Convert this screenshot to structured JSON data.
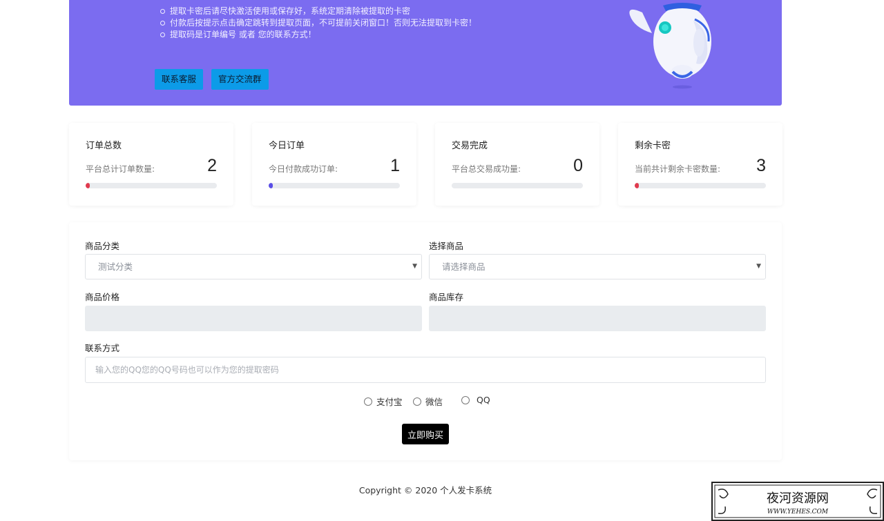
{
  "banner": {
    "notes": [
      "提取卡密后请尽快激活使用或保存好，系统定期清除被提取的卡密",
      "付款后按提示点击确定跳转到提取页面，不可提前关闭窗口！否则无法提取到卡密！",
      "提取码是订单编号 或者 您的联系方式！"
    ],
    "service_button": "联系客服",
    "group_button": "官方交流群",
    "color": "#7b6cf0"
  },
  "stats": [
    {
      "title": "订单总数",
      "subtitle": "平台总计订单数量:",
      "value": "2",
      "progress": 0.02,
      "bar_color": "#e03a4e"
    },
    {
      "title": "今日订单",
      "subtitle": "今日付款成功订单:",
      "value": "1",
      "progress": 0.01,
      "bar_color": "#5a4ee6"
    },
    {
      "title": "交易完成",
      "subtitle": "平台总交易成功量:",
      "value": "0",
      "progress": 0,
      "bar_color": "#28a745"
    },
    {
      "title": "剩余卡密",
      "subtitle": "当前共计剩余卡密数量:",
      "value": "3",
      "progress": 0.03,
      "bar_color": "#e03a4e"
    }
  ],
  "form": {
    "category_label": "商品分类",
    "category_value": "测试分类",
    "product_label": "选择商品",
    "product_value": "请选择商品",
    "price_label": "商品价格",
    "stock_label": "商品库存",
    "contact_label": "联系方式",
    "contact_placeholder": "输入您的QQ您的QQ号码也可以作为您的提取密码",
    "payment_options": [
      "支付宝",
      "微信",
      "QQ"
    ],
    "buy_button": "立即购买"
  },
  "footer": {
    "copyright": "Copyright © 2020 个人发卡系统"
  },
  "watermark": {
    "text": "夜河资源网",
    "url_text": "WWW.YEHES.COM"
  }
}
